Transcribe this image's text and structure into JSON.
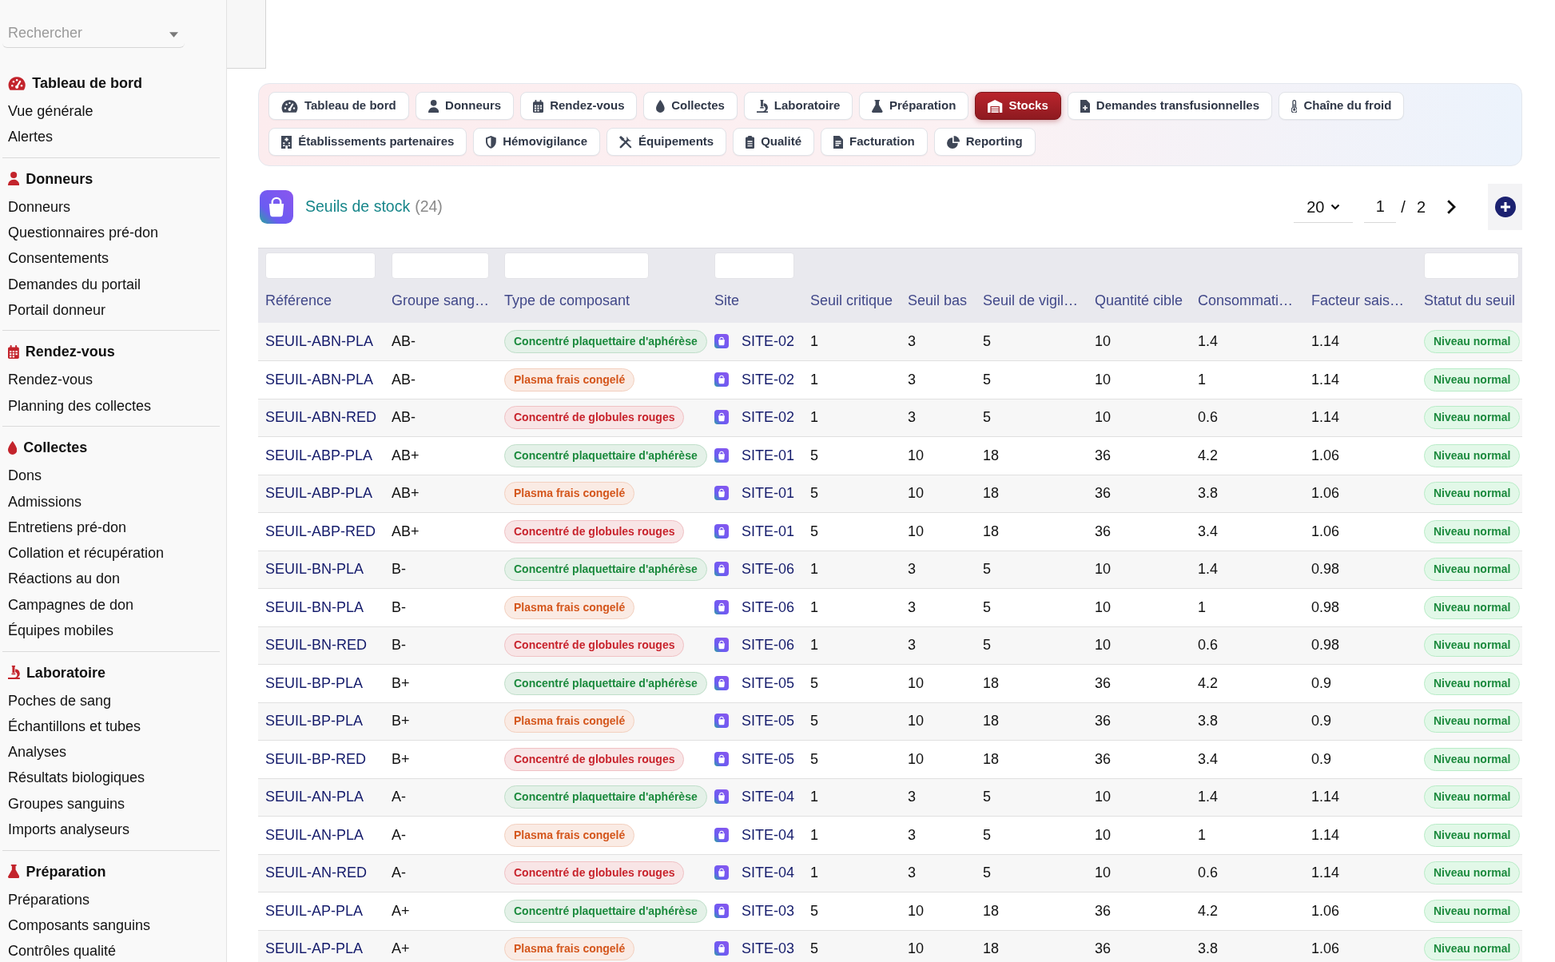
{
  "sidebar": {
    "search": {
      "placeholder": "Rechercher"
    },
    "sections": [
      {
        "title": "Tableau de bord",
        "items": [
          "Vue générale",
          "Alertes"
        ]
      },
      {
        "title": "Donneurs",
        "items": [
          "Donneurs",
          "Questionnaires pré-don",
          "Consentements",
          "Demandes du portail",
          "Portail donneur"
        ]
      },
      {
        "title": "Rendez-vous",
        "items": [
          "Rendez-vous",
          "Planning des collectes"
        ]
      },
      {
        "title": "Collectes",
        "items": [
          "Dons",
          "Admissions",
          "Entretiens pré-don",
          "Collation et récupération",
          "Réactions au don",
          "Campagnes de don",
          "Équipes mobiles"
        ]
      },
      {
        "title": "Laboratoire",
        "items": [
          "Poches de sang",
          "Échantillons et tubes",
          "Analyses",
          "Résultats biologiques",
          "Groupes sanguins",
          "Imports analyseurs"
        ]
      },
      {
        "title": "Préparation",
        "items": [
          "Préparations",
          "Composants sanguins",
          "Contrôles qualité"
        ]
      }
    ]
  },
  "tabs": [
    {
      "label": "Tableau de bord",
      "selected": false
    },
    {
      "label": "Donneurs",
      "selected": false
    },
    {
      "label": "Rendez-vous",
      "selected": false
    },
    {
      "label": "Collectes",
      "selected": false
    },
    {
      "label": "Laboratoire",
      "selected": false
    },
    {
      "label": "Préparation",
      "selected": false
    },
    {
      "label": "Stocks",
      "selected": true
    },
    {
      "label": "Demandes transfusionnelles",
      "selected": false
    },
    {
      "label": "Chaîne du froid",
      "selected": false
    },
    {
      "label": "Établissements partenaires",
      "selected": false
    },
    {
      "label": "Hémovigilance",
      "selected": false
    },
    {
      "label": "Équipements",
      "selected": false
    },
    {
      "label": "Qualité",
      "selected": false
    },
    {
      "label": "Facturation",
      "selected": false
    },
    {
      "label": "Reporting",
      "selected": false
    }
  ],
  "header": {
    "title": "Seuils de stock",
    "count": "(24)"
  },
  "pagination": {
    "page_size": "20",
    "page": "1",
    "separator": "/",
    "total_pages": "2"
  },
  "table": {
    "columns": [
      {
        "label": "Référence",
        "kind": "link",
        "filter": true
      },
      {
        "label": "Groupe sang…",
        "kind": "text",
        "filter": true
      },
      {
        "label": "Type de composant",
        "kind": "badge",
        "filter": true
      },
      {
        "label": "Site",
        "kind": "site",
        "filter": true
      },
      {
        "label": "Seuil critique",
        "kind": "text",
        "filter": false
      },
      {
        "label": "Seuil bas",
        "kind": "text",
        "filter": false
      },
      {
        "label": "Seuil de vigil…",
        "kind": "text",
        "filter": false
      },
      {
        "label": "Quantité cible",
        "kind": "text",
        "filter": false
      },
      {
        "label": "Consommati…",
        "kind": "text",
        "filter": false
      },
      {
        "label": "Facteur sais…",
        "kind": "text",
        "filter": false
      },
      {
        "label": "Statut du seuil",
        "kind": "status",
        "filter": true
      }
    ],
    "rows": [
      {
        "cells": [
          "SEUIL-ABN-PLA",
          "AB-",
          {
            "label": "Concentré plaquettaire d'aphérèse",
            "color": "#1b8a3d"
          },
          "SITE-02",
          "1",
          "3",
          "5",
          "10",
          "1.4",
          "1.14",
          "Niveau normal"
        ]
      },
      {
        "cells": [
          "SEUIL-ABN-PLA",
          "AB-",
          {
            "label": "Plasma frais congelé",
            "color": "#d4561c"
          },
          "SITE-02",
          "1",
          "3",
          "5",
          "10",
          "1",
          "1.14",
          "Niveau normal"
        ]
      },
      {
        "cells": [
          "SEUIL-ABN-RED",
          "AB-",
          {
            "label": "Concentré de globules rouges",
            "color": "#c8232c"
          },
          "SITE-02",
          "1",
          "3",
          "5",
          "10",
          "0.6",
          "1.14",
          "Niveau normal"
        ]
      },
      {
        "cells": [
          "SEUIL-ABP-PLA",
          "AB+",
          {
            "label": "Concentré plaquettaire d'aphérèse",
            "color": "#1b8a3d"
          },
          "SITE-01",
          "5",
          "10",
          "18",
          "36",
          "4.2",
          "1.06",
          "Niveau normal"
        ]
      },
      {
        "cells": [
          "SEUIL-ABP-PLA",
          "AB+",
          {
            "label": "Plasma frais congelé",
            "color": "#d4561c"
          },
          "SITE-01",
          "5",
          "10",
          "18",
          "36",
          "3.8",
          "1.06",
          "Niveau normal"
        ]
      },
      {
        "cells": [
          "SEUIL-ABP-RED",
          "AB+",
          {
            "label": "Concentré de globules rouges",
            "color": "#c8232c"
          },
          "SITE-01",
          "5",
          "10",
          "18",
          "36",
          "3.4",
          "1.06",
          "Niveau normal"
        ]
      },
      {
        "cells": [
          "SEUIL-BN-PLA",
          "B-",
          {
            "label": "Concentré plaquettaire d'aphérèse",
            "color": "#1b8a3d"
          },
          "SITE-06",
          "1",
          "3",
          "5",
          "10",
          "1.4",
          "0.98",
          "Niveau normal"
        ]
      },
      {
        "cells": [
          "SEUIL-BN-PLA",
          "B-",
          {
            "label": "Plasma frais congelé",
            "color": "#d4561c"
          },
          "SITE-06",
          "1",
          "3",
          "5",
          "10",
          "1",
          "0.98",
          "Niveau normal"
        ]
      },
      {
        "cells": [
          "SEUIL-BN-RED",
          "B-",
          {
            "label": "Concentré de globules rouges",
            "color": "#c8232c"
          },
          "SITE-06",
          "1",
          "3",
          "5",
          "10",
          "0.6",
          "0.98",
          "Niveau normal"
        ]
      },
      {
        "cells": [
          "SEUIL-BP-PLA",
          "B+",
          {
            "label": "Concentré plaquettaire d'aphérèse",
            "color": "#1b8a3d"
          },
          "SITE-05",
          "5",
          "10",
          "18",
          "36",
          "4.2",
          "0.9",
          "Niveau normal"
        ]
      },
      {
        "cells": [
          "SEUIL-BP-PLA",
          "B+",
          {
            "label": "Plasma frais congelé",
            "color": "#d4561c"
          },
          "SITE-05",
          "5",
          "10",
          "18",
          "36",
          "3.8",
          "0.9",
          "Niveau normal"
        ]
      },
      {
        "cells": [
          "SEUIL-BP-RED",
          "B+",
          {
            "label": "Concentré de globules rouges",
            "color": "#c8232c"
          },
          "SITE-05",
          "5",
          "10",
          "18",
          "36",
          "3.4",
          "0.9",
          "Niveau normal"
        ]
      },
      {
        "cells": [
          "SEUIL-AN-PLA",
          "A-",
          {
            "label": "Concentré plaquettaire d'aphérèse",
            "color": "#1b8a3d"
          },
          "SITE-04",
          "1",
          "3",
          "5",
          "10",
          "1.4",
          "1.14",
          "Niveau normal"
        ]
      },
      {
        "cells": [
          "SEUIL-AN-PLA",
          "A-",
          {
            "label": "Plasma frais congelé",
            "color": "#d4561c"
          },
          "SITE-04",
          "1",
          "3",
          "5",
          "10",
          "1",
          "1.14",
          "Niveau normal"
        ]
      },
      {
        "cells": [
          "SEUIL-AN-RED",
          "A-",
          {
            "label": "Concentré de globules rouges",
            "color": "#c8232c"
          },
          "SITE-04",
          "1",
          "3",
          "5",
          "10",
          "0.6",
          "1.14",
          "Niveau normal"
        ]
      },
      {
        "cells": [
          "SEUIL-AP-PLA",
          "A+",
          {
            "label": "Concentré plaquettaire d'aphérèse",
            "color": "#1b8a3d"
          },
          "SITE-03",
          "5",
          "10",
          "18",
          "36",
          "4.2",
          "1.06",
          "Niveau normal"
        ]
      },
      {
        "cells": [
          "SEUIL-AP-PLA",
          "A+",
          {
            "label": "Plasma frais congelé",
            "color": "#d4561c"
          },
          "SITE-03",
          "5",
          "10",
          "18",
          "36",
          "3.8",
          "1.06",
          "Niveau normal"
        ]
      }
    ]
  }
}
